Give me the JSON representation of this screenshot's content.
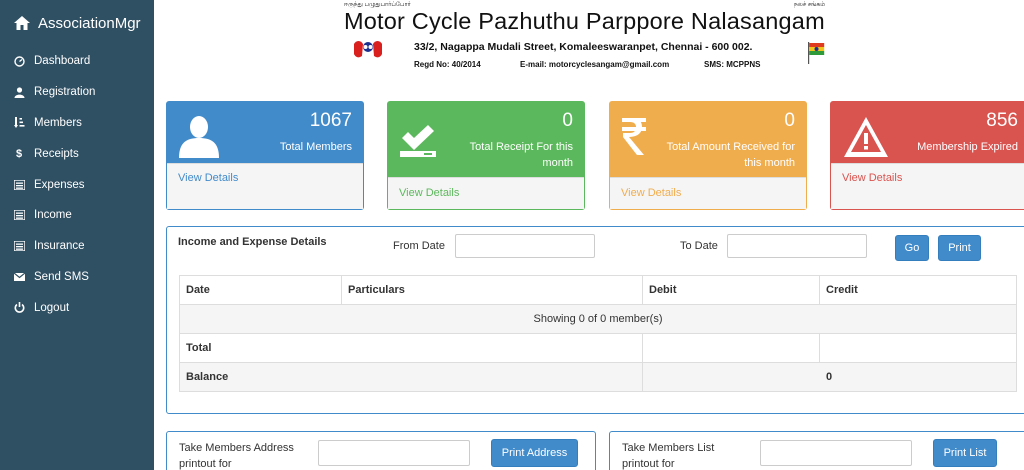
{
  "sidebar": {
    "brand": "AssociationMgr",
    "items": [
      {
        "label": "Dashboard",
        "icon": "dashboard-icon"
      },
      {
        "label": "Registration",
        "icon": "user-icon"
      },
      {
        "label": "Members",
        "icon": "sort-icon"
      },
      {
        "label": "Receipts",
        "icon": "dollar-icon"
      },
      {
        "label": "Expenses",
        "icon": "list-icon"
      },
      {
        "label": "Income",
        "icon": "list-icon"
      },
      {
        "label": "Insurance",
        "icon": "list-icon"
      },
      {
        "label": "Send SMS",
        "icon": "envelope-icon"
      },
      {
        "label": "Logout",
        "icon": "power-icon"
      }
    ]
  },
  "header": {
    "tamil_left": "ஈருந்து பழுதுபார்ப்போர்",
    "tamil_right": "நலச் சங்கம்",
    "title": "Motor Cycle Pazhuthu Parppore Nalasangam",
    "address": "33/2, Nagappa Mudali Street, Komaleeswaranpet, Chennai - 600 002.",
    "regd": "Regd No: 40/2014",
    "email": "E-mail: motorcyclesangam@gmail.com",
    "sms": "SMS: MCPPNS"
  },
  "cards": {
    "members": {
      "value": "1067",
      "label": "Total Members",
      "link": "View Details"
    },
    "receipt": {
      "value": "0",
      "label_1": "Total Receipt For this",
      "label_2": "month",
      "link": "View Details"
    },
    "amount": {
      "value": "0",
      "label_1": "Total Amount Received for",
      "label_2": "this month",
      "link": "View Details"
    },
    "expired": {
      "value": "856",
      "label": "Membership Expired",
      "link": "View Details"
    }
  },
  "income_expense": {
    "title": "Income and Expense Details",
    "from_label": "From Date",
    "to_label": "To Date",
    "go_label": "Go",
    "print_label": "Print",
    "columns": [
      "Date",
      "Particulars",
      "Debit",
      "Credit"
    ],
    "empty_message": "Showing 0 of 0 member(s)",
    "total_label": "Total",
    "balance_label": "Balance",
    "balance_value": "0"
  },
  "bottom": {
    "address_label": "Take Members Address printout for",
    "address_button": "Print Address",
    "list_label": "Take Members List printout for",
    "list_button": "Print List"
  },
  "colors": {
    "sidebar": "#2f4f63",
    "primary": "#428bca",
    "success": "#5cb85c",
    "warning": "#f0ad4e",
    "danger": "#d9534f"
  }
}
